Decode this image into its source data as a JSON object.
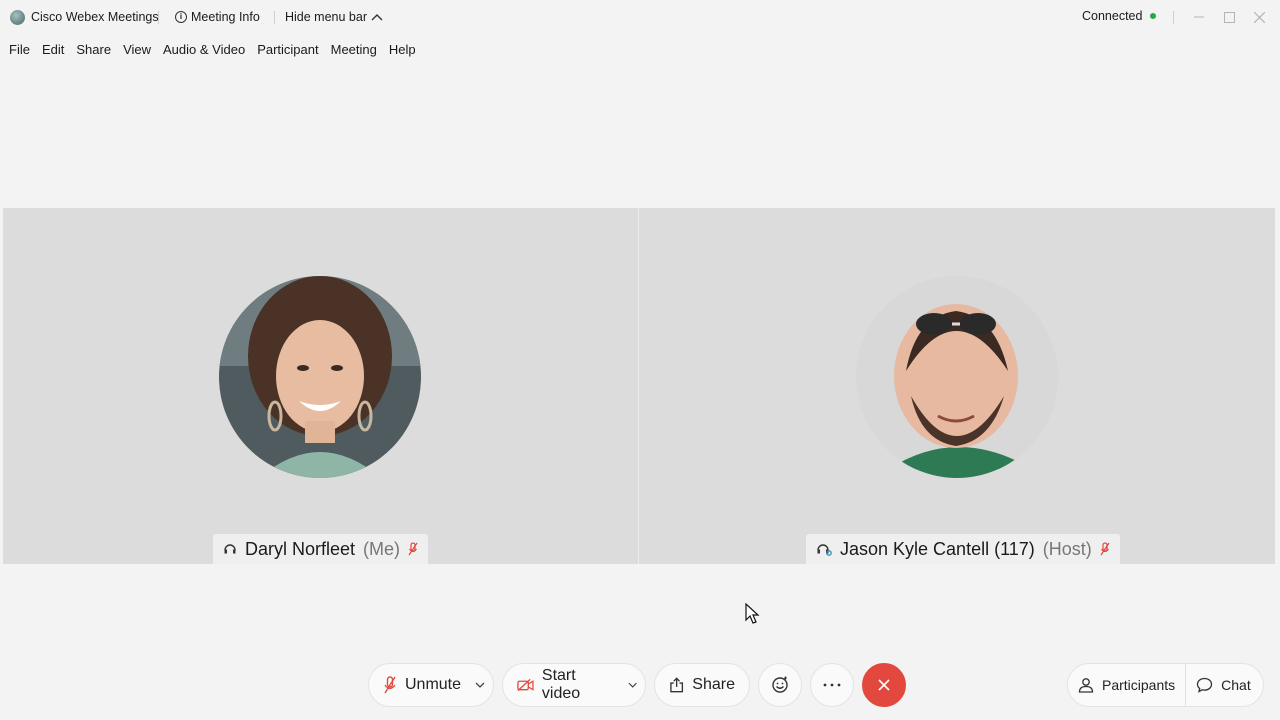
{
  "window": {
    "app_title": "Cisco Webex Meetings",
    "meeting_info_label": "Meeting Info",
    "hide_menu_label": "Hide menu bar",
    "status_label": "Connected",
    "status_color": "#27a745"
  },
  "menu": {
    "items": [
      "File",
      "Edit",
      "Share",
      "View",
      "Audio & Video",
      "Participant",
      "Meeting",
      "Help"
    ]
  },
  "participants": [
    {
      "name": "Daryl Norfleet",
      "role": "(Me)",
      "muted": true,
      "avatar_icon": "avatar-photo-woman"
    },
    {
      "name": "Jason Kyle Cantell (117)",
      "role": "(Host)",
      "muted": true,
      "avatar_icon": "avatar-photo-man"
    }
  ],
  "controls": {
    "unmute_label": "Unmute",
    "start_video_label": "Start video",
    "share_label": "Share",
    "participants_label": "Participants",
    "chat_label": "Chat",
    "end_color": "#e2483d",
    "mute_icon_color": "#e2483d"
  }
}
